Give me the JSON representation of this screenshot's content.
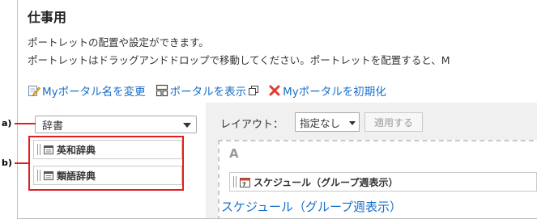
{
  "page": {
    "title": "仕事用",
    "description_line1": "ポートレットの配置や設定ができます。",
    "description_line2": "ポートレットはドラッグアンドドロップで移動してください。ポートレットを配置すると、M"
  },
  "actions": {
    "rename_label": "Myポータル名を変更",
    "show_label": "ポータルを表示",
    "reset_label": "Myポータルを初期化"
  },
  "left_panel": {
    "category_select": "辞書",
    "portlets": [
      "英和辞典",
      "類語辞典"
    ]
  },
  "layout_bar": {
    "label": "レイアウト：",
    "select_value": "指定なし",
    "apply_button": "適用する"
  },
  "area_a": {
    "label": "A",
    "portlet_header": "スケジュール（グループ週表示）",
    "portlet_link": "スケジュール（グループ週表示）"
  },
  "callouts": {
    "a": "a)",
    "b": "b)"
  },
  "colors": {
    "link": "#1a6fc9",
    "callout_red": "#e02020",
    "reset_icon": "#e23b2e"
  }
}
